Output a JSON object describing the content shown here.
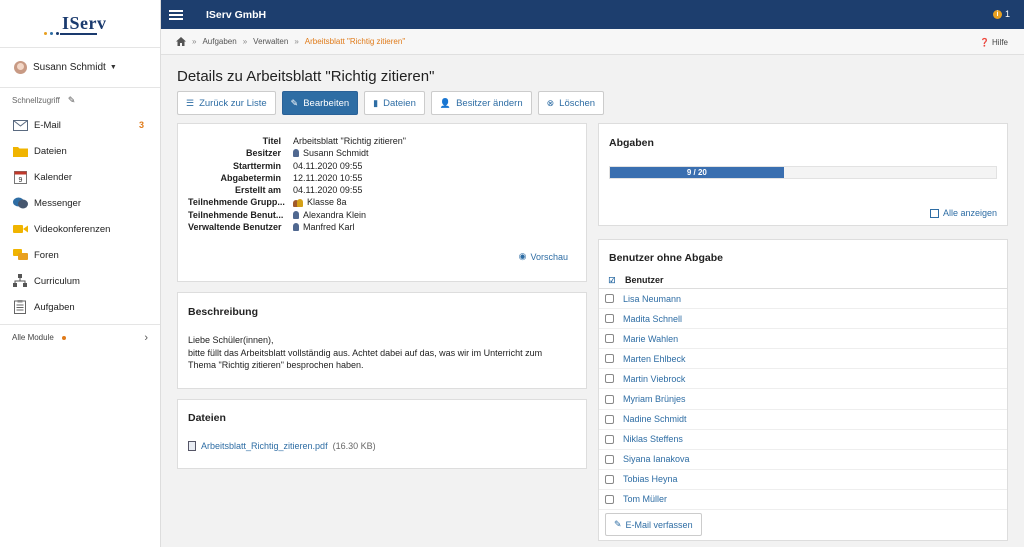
{
  "app": {
    "logo_text": "IServ",
    "org_name": "IServ GmbH",
    "notification_count": "1",
    "help_label": "Hilfe"
  },
  "user": {
    "name": "Susann Schmidt"
  },
  "sidebar": {
    "quick_access_label": "Schnellzugriff",
    "items": [
      {
        "label": "E-Mail",
        "badge": "3",
        "icon": "mail-icon"
      },
      {
        "label": "Dateien",
        "badge": "",
        "icon": "folder-icon"
      },
      {
        "label": "Kalender",
        "badge": "",
        "icon": "calendar-icon"
      },
      {
        "label": "Messenger",
        "badge": "",
        "icon": "chat-icon"
      },
      {
        "label": "Videokonferenzen",
        "badge": "",
        "icon": "video-icon"
      },
      {
        "label": "Foren",
        "badge": "",
        "icon": "forum-icon"
      },
      {
        "label": "Curriculum",
        "badge": "",
        "icon": "curriculum-icon"
      },
      {
        "label": "Aufgaben",
        "badge": "",
        "icon": "tasks-icon"
      }
    ],
    "calendar_day": "9",
    "all_modules_label": "Alle Module"
  },
  "breadcrumb": {
    "items": [
      "Aufgaben",
      "Verwalten"
    ],
    "current": "Arbeitsblatt \"Richtig zitieren\""
  },
  "page": {
    "title": "Details zu Arbeitsblatt \"Richtig zitieren\""
  },
  "toolbar": {
    "back": "Zurück zur Liste",
    "edit": "Bearbeiten",
    "files": "Dateien",
    "owner": "Besitzer ändern",
    "delete": "Löschen"
  },
  "details": {
    "rows": [
      {
        "label": "Titel",
        "value": "Arbeitsblatt \"Richtig zitieren\""
      },
      {
        "label": "Besitzer",
        "value": "Susann Schmidt"
      },
      {
        "label": "Starttermin",
        "value": "04.11.2020 09:55"
      },
      {
        "label": "Abgabetermin",
        "value": "12.11.2020 10:55"
      },
      {
        "label": "Erstellt am",
        "value": "04.11.2020 09:55"
      },
      {
        "label": "Teilnehmende Grupp...",
        "value": "Klasse 8a"
      },
      {
        "label": "Teilnehmende Benut...",
        "value": "Alexandra Klein"
      },
      {
        "label": "Verwaltende Benutzer",
        "value": "Manfred Karl"
      }
    ],
    "preview_label": "Vorschau"
  },
  "description": {
    "heading": "Beschreibung",
    "line1": "Liebe Schüler(innen),",
    "line2": "bitte füllt das Arbeitsblatt vollständig aus. Achtet dabei auf das, was wir im Unterricht zum",
    "line3": "Thema \"Richtig zitieren\" besprochen haben."
  },
  "files": {
    "heading": "Dateien",
    "name": "Arbeitsblatt_Richtig_zitieren.pdf",
    "size": "(16.30 KB)"
  },
  "submissions": {
    "heading": "Abgaben",
    "progress_text": "9 / 20",
    "progress_fraction": 0.45,
    "show_all": "Alle anzeigen"
  },
  "missing": {
    "heading": "Benutzer ohne Abgabe",
    "column": "Benutzer",
    "users": [
      "Lisa Neumann",
      "Madita Schnell",
      "Marie Wahlen",
      "Marten Ehlbeck",
      "Martin Viebrock",
      "Myriam Brünjes",
      "Nadine Schmidt",
      "Niklas Steffens",
      "Siyana Ianakova",
      "Tobias Heyna",
      "Tom Müller"
    ],
    "compose_label": "E-Mail verfassen"
  },
  "colors": {
    "brand": "#1d3e6e",
    "accent": "#2e6da4",
    "highlight": "#e07b1a"
  }
}
